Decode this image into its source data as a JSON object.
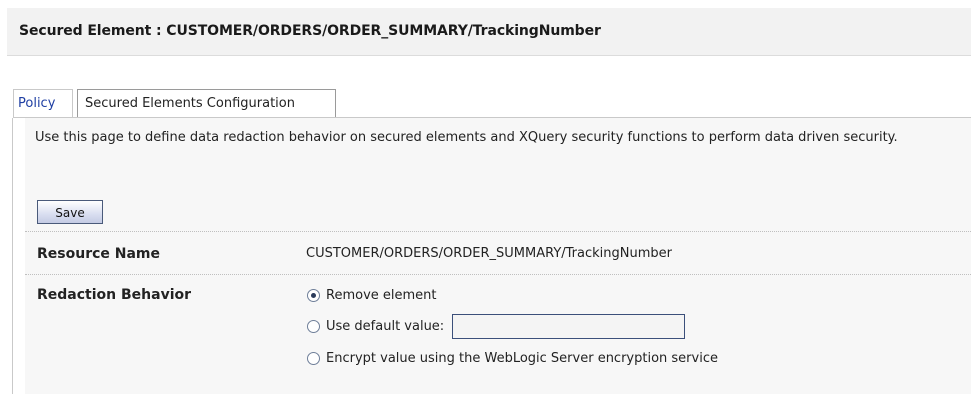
{
  "header": {
    "title": "Secured Element : CUSTOMER/ORDERS/ORDER_SUMMARY/TrackingNumber"
  },
  "tabs": [
    {
      "label": "Policy",
      "active": false
    },
    {
      "label": "Secured Elements Configuration",
      "active": true
    }
  ],
  "description": "Use this page to define data redaction behavior on secured elements and XQuery security functions to perform data driven security.",
  "save_label": "Save",
  "resource": {
    "label": "Resource Name",
    "value": "CUSTOMER/ORDERS/ORDER_SUMMARY/TrackingNumber"
  },
  "redaction": {
    "label": "Redaction Behavior",
    "options": [
      {
        "label": "Remove element",
        "checked": true
      },
      {
        "label": "Use default value:",
        "checked": false,
        "input_value": ""
      },
      {
        "label": "Encrypt value using the WebLogic Server encryption service",
        "checked": false
      }
    ]
  }
}
